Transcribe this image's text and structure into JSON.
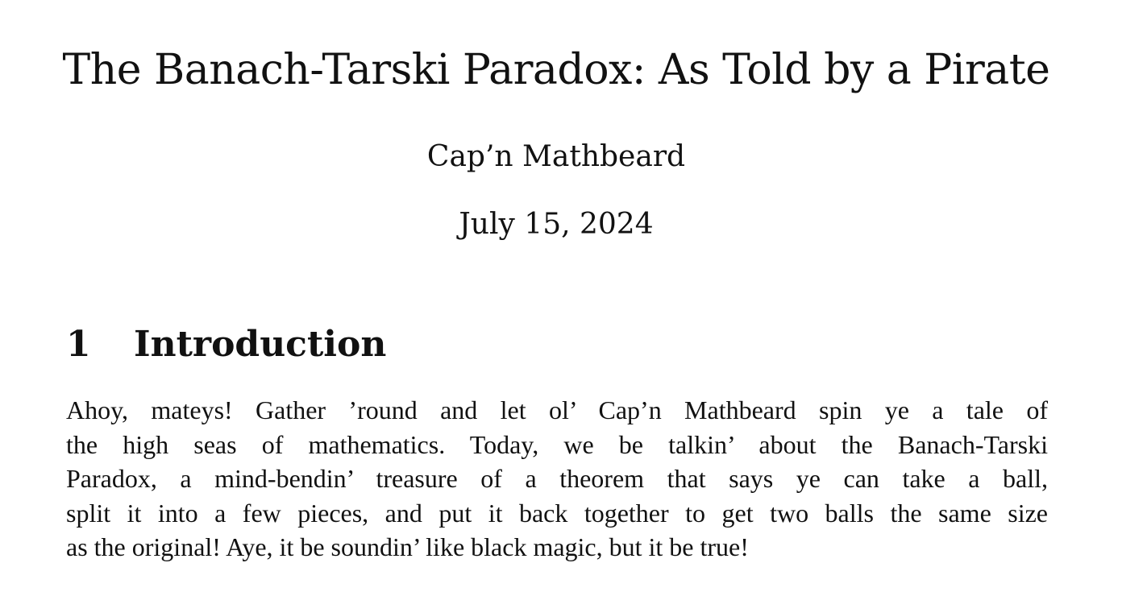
{
  "title": "The Banach-Tarski Paradox: As Told by a Pirate",
  "author": "Cap’n Mathbeard",
  "date": "July 15, 2024",
  "section": {
    "number": "1",
    "heading": "Introduction"
  },
  "paragraph_lines": [
    "Ahoy, mateys! Gather ’round and let ol’ Cap’n Mathbeard spin ye a tale of",
    "the high seas of mathematics. Today, we be talkin’ about the Banach-Tarski",
    "Paradox, a mind-bendin’ treasure of a theorem that says ye can take a ball,",
    "split it into a few pieces, and put it back together to get two balls the same size",
    "as the original! Aye, it be soundin’ like black magic, but it be true!"
  ]
}
